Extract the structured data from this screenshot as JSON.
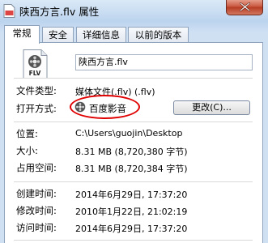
{
  "window": {
    "title": "陕西方言.flv 属性"
  },
  "tabs": [
    {
      "label": "常规"
    },
    {
      "label": "安全"
    },
    {
      "label": "详细信息"
    },
    {
      "label": "以前的版本"
    }
  ],
  "general": {
    "filename": "陕西方言.flv",
    "file_icon_text": "FLV",
    "type_label": "文件类型:",
    "type_value": "媒体文件(.flv) (.flv)",
    "opens_with_label": "打开方式:",
    "opens_with_value": "百度影音",
    "change_button": "更改(C)...",
    "location_label": "位置:",
    "location_value": "C:\\Users\\guojin\\Desktop",
    "size_label": "大小:",
    "size_value": "8.31 MB (8,720,380 字节)",
    "size_on_disk_label": "占用空间:",
    "size_on_disk_value": "8.31 MB (8,720,384 字节)",
    "created_label": "创建时间:",
    "created_value": "2014年6月29日, 17:37:20",
    "modified_label": "修改时间:",
    "modified_value": "2010年1月22日, 21:02:19",
    "accessed_label": "访问时间:",
    "accessed_value": "2014年6月29日, 17:37:20"
  },
  "colors": {
    "highlight": "#e00000",
    "accent": "#cfe0f3"
  }
}
